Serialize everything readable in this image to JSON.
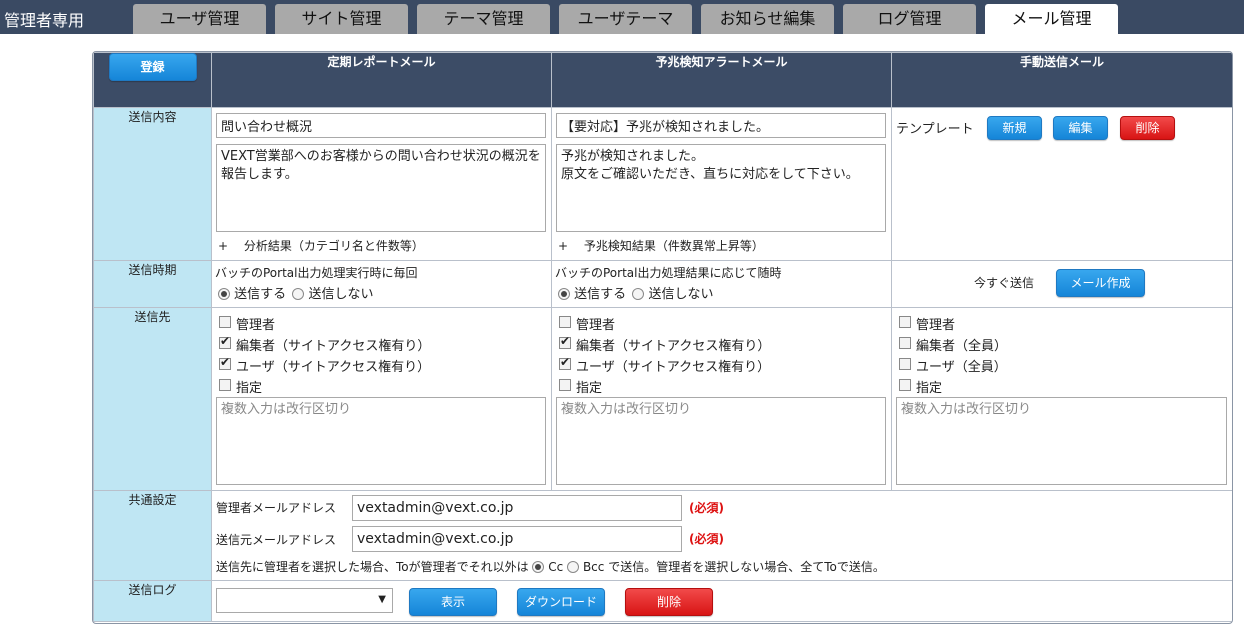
{
  "brand": "管理者専用",
  "tabs": [
    {
      "label": "ユーザ管理",
      "active": false
    },
    {
      "label": "サイト管理",
      "active": false
    },
    {
      "label": "テーマ管理",
      "active": false
    },
    {
      "label": "ユーザテーマ",
      "active": false
    },
    {
      "label": "お知らせ編集",
      "active": false
    },
    {
      "label": "ログ管理",
      "active": false
    },
    {
      "label": "メール管理",
      "active": true
    }
  ],
  "header": {
    "register_button": "登録",
    "col1": "定期レポートメール",
    "col2": "予兆検知アラートメール",
    "col3": "手動送信メール"
  },
  "rows": {
    "content": "送信内容",
    "timing": "送信時期",
    "recipients": "送信先",
    "common": "共通設定",
    "log": "送信ログ"
  },
  "report": {
    "subject": "問い合わせ概況",
    "body": "VEXT営業部へのお客様からの問い合わせ状況の概況を報告します。",
    "append": "+　 分析結果（カテゴリ名と件数等）",
    "timing_text": "バッチのPortal出力処理実行時に毎回",
    "send_label": "送信する",
    "nosend_label": "送信しない",
    "send_selected": true,
    "recipients": [
      {
        "label": "管理者",
        "checked": false
      },
      {
        "label": "編集者（サイトアクセス権有り）",
        "checked": true
      },
      {
        "label": "ユーザ（サイトアクセス権有り）",
        "checked": true
      },
      {
        "label": "指定",
        "checked": false
      }
    ],
    "addr_placeholder": "複数入力は改行区切り"
  },
  "alert": {
    "subject": "【要対応】予兆が検知されました。",
    "body": "予兆が検知されました。\n原文をご確認いただき、直ちに対応をして下さい。",
    "append": "+　 予兆検知結果（件数異常上昇等）",
    "timing_text": "バッチのPortal出力処理結果に応じて随時",
    "send_label": "送信する",
    "nosend_label": "送信しない",
    "send_selected": true,
    "recipients": [
      {
        "label": "管理者",
        "checked": false
      },
      {
        "label": "編集者（サイトアクセス権有り）",
        "checked": true
      },
      {
        "label": "ユーザ（サイトアクセス権有り）",
        "checked": true
      },
      {
        "label": "指定",
        "checked": false
      }
    ],
    "addr_placeholder": "複数入力は改行区切り"
  },
  "manual": {
    "template_label": "テンプレート",
    "new_button": "新規",
    "edit_button": "編集",
    "delete_button": "削除",
    "send_now_label": "今すぐ送信",
    "compose_button": "メール作成",
    "recipients": [
      {
        "label": "管理者",
        "checked": false
      },
      {
        "label": "編集者（全員）",
        "checked": false
      },
      {
        "label": "ユーザ（全員）",
        "checked": false
      },
      {
        "label": "指定",
        "checked": false
      }
    ],
    "addr_placeholder": "複数入力は改行区切り"
  },
  "common": {
    "admin_mail_label": "管理者メールアドレス",
    "admin_mail_value": "vextadmin@vext.co.jp",
    "from_mail_label": "送信元メールアドレス",
    "from_mail_value": "vextadmin@vext.co.jp",
    "required": "(必須)",
    "note_before": "送信先に管理者を選択した場合、Toが管理者でそれ以外は",
    "cc_label": "Cc",
    "bcc_label": "Bcc",
    "note_after": "で送信。管理者を選択しない場合、全てToで送信。",
    "cc_selected": true
  },
  "log": {
    "select_value": "",
    "show_button": "表示",
    "download_button": "ダウンロード",
    "delete_button": "削除"
  }
}
